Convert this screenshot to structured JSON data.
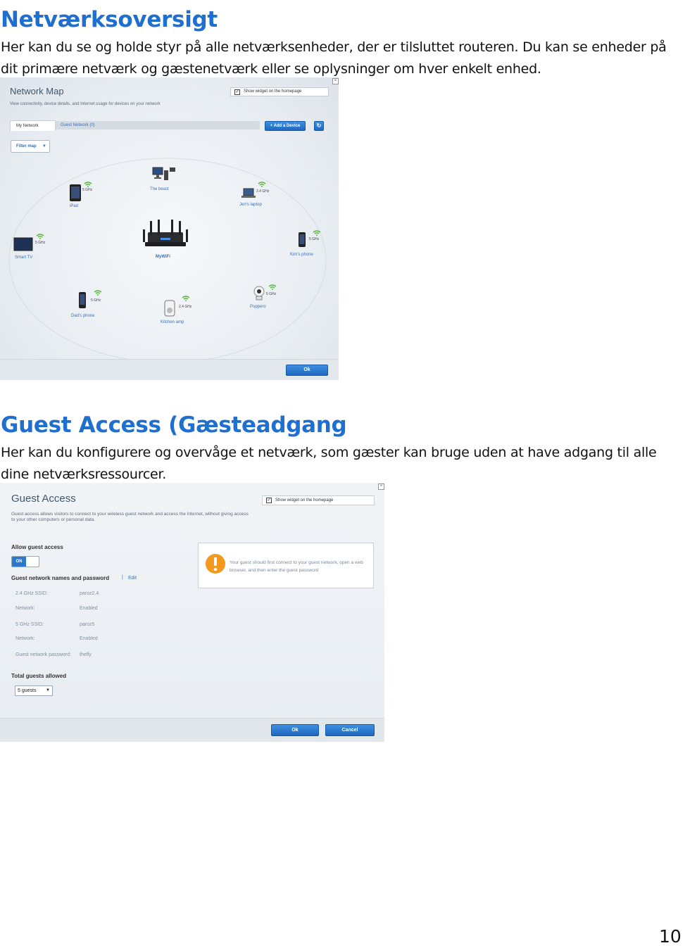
{
  "section1": {
    "heading": "Netværksoversigt",
    "paragraph": "Her kan du se og holde styr på alle netværksenheder, der er tilsluttet routeren. Du kan se enheder på dit primære netværk og gæstenetværk eller se oplysninger om hver enkelt enhed."
  },
  "network_map": {
    "title": "Network Map",
    "subtitle": "View connectivity, device details, and Internet usage for devices on your network",
    "widget_label": "Show widget on the homepage",
    "tabs": [
      {
        "label": "My Network"
      },
      {
        "label": "Guest Network (0)"
      }
    ],
    "add_device_label": "+ Add a Device",
    "filter_label": "Filter map",
    "router_name": "MyWiFi",
    "devices": [
      {
        "name": "iPad",
        "band": "5 GHz"
      },
      {
        "name": "The beast",
        "band": ""
      },
      {
        "name": "Jen's laptop",
        "band": "2.4 GHz"
      },
      {
        "name": "Smart TV",
        "band": "5 GHz"
      },
      {
        "name": "Kim's phone",
        "band": "5 GHz"
      },
      {
        "name": "Dad's phone",
        "band": "5 GHz"
      },
      {
        "name": "Kitchen amp",
        "band": "2.4 GHz"
      },
      {
        "name": "Puppero",
        "band": "5 GHz"
      }
    ],
    "ok_label": "Ok"
  },
  "section2": {
    "heading": "Guest Access (Gæsteadgang",
    "paragraph": "Her kan du konfigurere og overvåge et netværk, som gæster kan bruge uden at have adgang til alle dine netværksressourcer."
  },
  "guest_access": {
    "title": "Guest Access",
    "widget_label": "Show widget on the homepage",
    "description": "Guest access allows visitors to connect to your wireless guest network and access the Internet, without giving access to your other computers or personal data.",
    "allow_label": "Allow guest access",
    "toggle_state": "ON",
    "names_label": "Guest network names and password",
    "separator": "|",
    "edit_label": "Edit",
    "rows": [
      {
        "key": "2.4 GHz SSID:",
        "value": "paroz2.4"
      },
      {
        "key": "Network:",
        "value": "Enabled"
      },
      {
        "key": "5 GHz SSID:",
        "value": "paroz5"
      },
      {
        "key": "Network:",
        "value": "Enabled"
      },
      {
        "key": "Guest network password:",
        "value": "thefly"
      }
    ],
    "total_label": "Total guests allowed",
    "guests_value": "5 guests",
    "notice": "Your guest should first connect to your guest network, open a web browser, and then enter the guest password",
    "ok_label": "Ok",
    "cancel_label": "Cancel"
  },
  "page_number": "10",
  "colors": {
    "heading": "#1e6fd0",
    "accent_blue": "#2a78d0",
    "warning": "#f39a1e"
  }
}
